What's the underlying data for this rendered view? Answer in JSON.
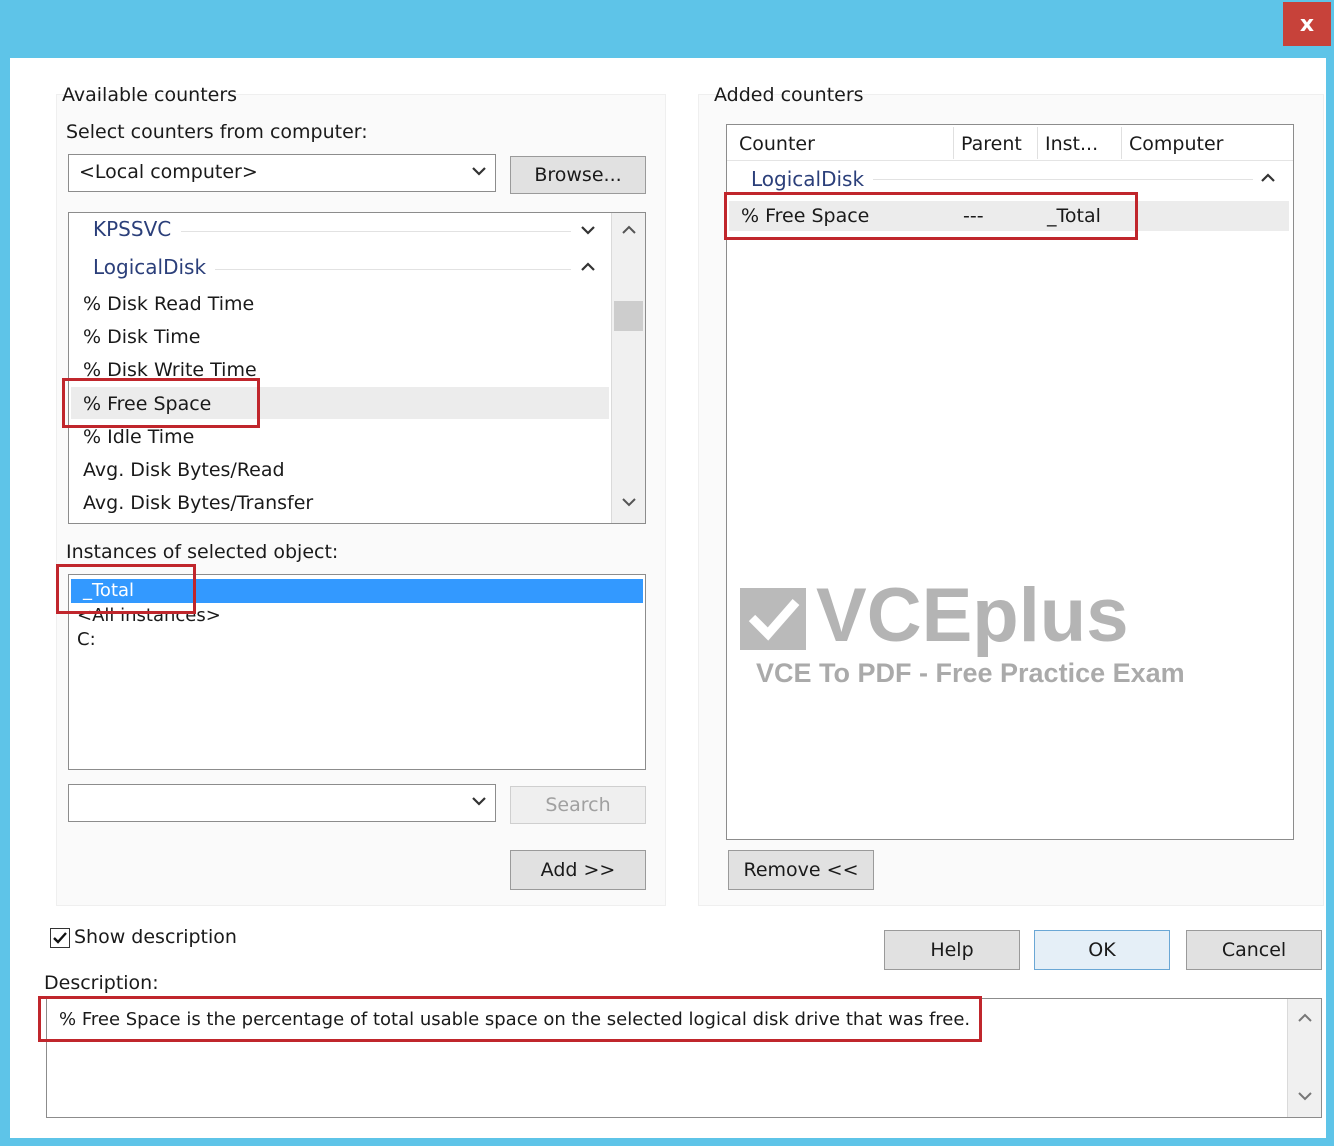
{
  "window": {
    "close_label": "x"
  },
  "available": {
    "group_label": "Available counters",
    "select_label": "Select counters from computer:",
    "computer_value": "<Local computer>",
    "browse_label": "Browse...",
    "counter_groups": [
      {
        "name": "KPSSVC",
        "expanded": false
      },
      {
        "name": "LogicalDisk",
        "expanded": true
      }
    ],
    "counters": [
      "% Disk Read Time",
      "% Disk Time",
      "% Disk Write Time",
      "% Free Space",
      "% Idle Time",
      "Avg. Disk Bytes/Read",
      "Avg. Disk Bytes/Transfer"
    ],
    "selected_counter": "% Free Space",
    "instances_label": "Instances of selected object:",
    "instances": [
      "_Total",
      "<All instances>",
      "C:"
    ],
    "search_value": "",
    "search_label": "Search",
    "add_label": "Add >>"
  },
  "added": {
    "group_label": "Added counters",
    "columns": [
      "Counter",
      "Parent",
      "Inst...",
      "Computer"
    ],
    "group_name": "LogicalDisk",
    "row": {
      "counter": "% Free Space",
      "parent": "---",
      "instance": "_Total",
      "computer": ""
    },
    "remove_label": "Remove <<"
  },
  "watermark": {
    "logo_text": "VCEplus",
    "subtitle": "VCE To PDF - Free Practice Exam"
  },
  "footer": {
    "show_description_label": "Show description",
    "show_description_checked": true,
    "help_label": "Help",
    "ok_label": "OK",
    "cancel_label": "Cancel",
    "description_label": "Description:",
    "description_text": "% Free Space is the percentage of total usable space on the selected logical disk drive that was free."
  },
  "colors": {
    "titlebar": "#5ec4e8",
    "close_button": "#c7423a",
    "highlight_border": "#c0262c",
    "selection": "#3399ff",
    "group_header_text": "#2b3f7a"
  }
}
